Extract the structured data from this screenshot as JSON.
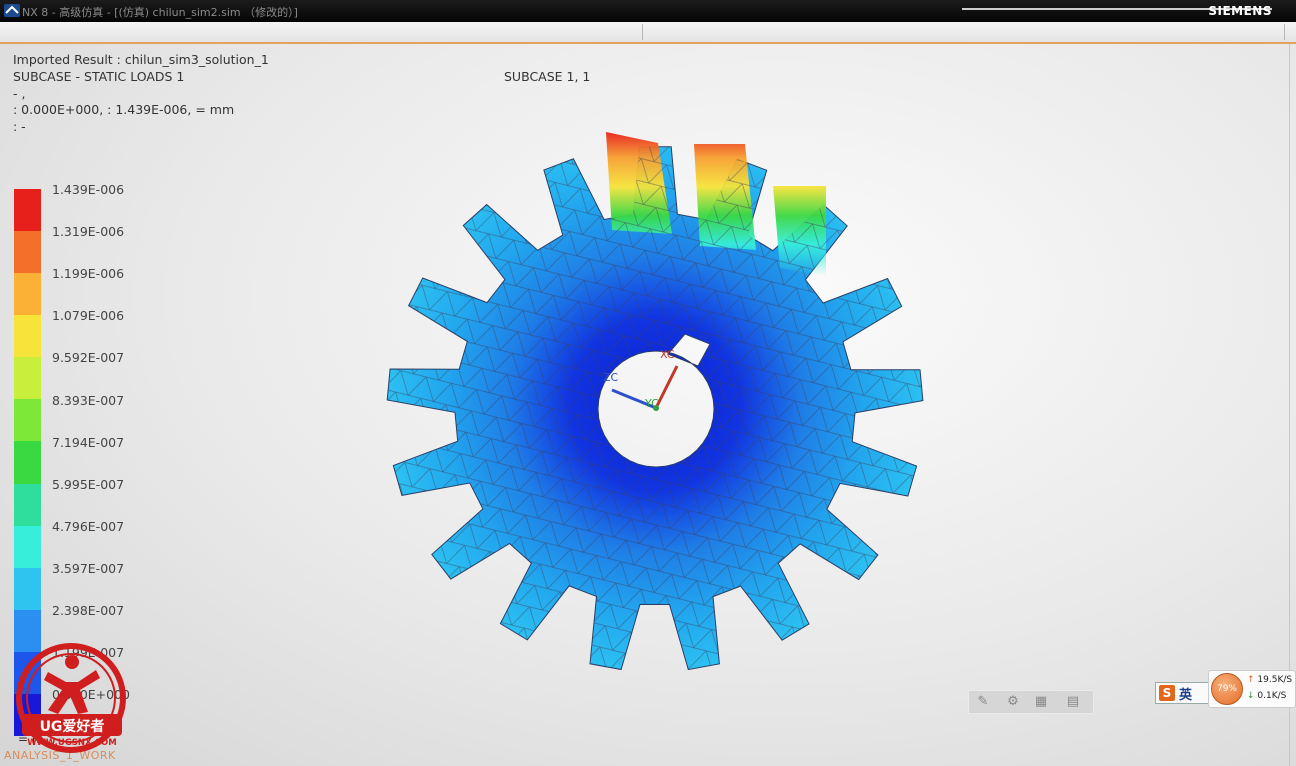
{
  "window": {
    "title": "NX 8 - 高级仿真 - [(仿真) chilun_sim2.sim （修改的）]",
    "brand": "SIEMENS"
  },
  "result_header": {
    "line1": "Imported Result : chilun_sim3_solution_1",
    "line2": "SUBCASE - STATIC LOADS 1",
    "line3": " - ,",
    "line4": " : 0.000E+000,  : 1.439E-006, = mm",
    "line5": " : -",
    "subcase_label": "SUBCASE 1, 1"
  },
  "legend": {
    "labels": [
      "1.439E-006",
      "1.319E-006",
      "1.199E-006",
      "1.079E-006",
      "9.592E-007",
      "8.393E-007",
      "7.194E-007",
      "5.995E-007",
      "4.796E-007",
      "3.597E-007",
      "2.398E-007",
      "1.199E-007",
      "0.000E+000"
    ],
    "colors": [
      "#e8201c",
      "#f4702a",
      "#fbb135",
      "#f6e43a",
      "#c8ef3c",
      "#7ee839",
      "#3ad841",
      "#2fdd9d",
      "#37eedb",
      "#2fc3ef",
      "#2a8ff0",
      "#1e55ea",
      "#1818d8"
    ],
    "unit": " = m"
  },
  "axes": {
    "xc": "XC",
    "yc": "YC",
    "zc": "ZC"
  },
  "status": {
    "work_part": "ANALYSIS_1_WORK"
  },
  "ime": {
    "icon": "S",
    "lang": "英"
  },
  "net_monitor": {
    "percent": "79%",
    "upload": "19.5K/S",
    "download": "0.1K/S"
  },
  "logo": {
    "text": "UG爱好者",
    "url": "WWW.UGSNX.COM"
  }
}
